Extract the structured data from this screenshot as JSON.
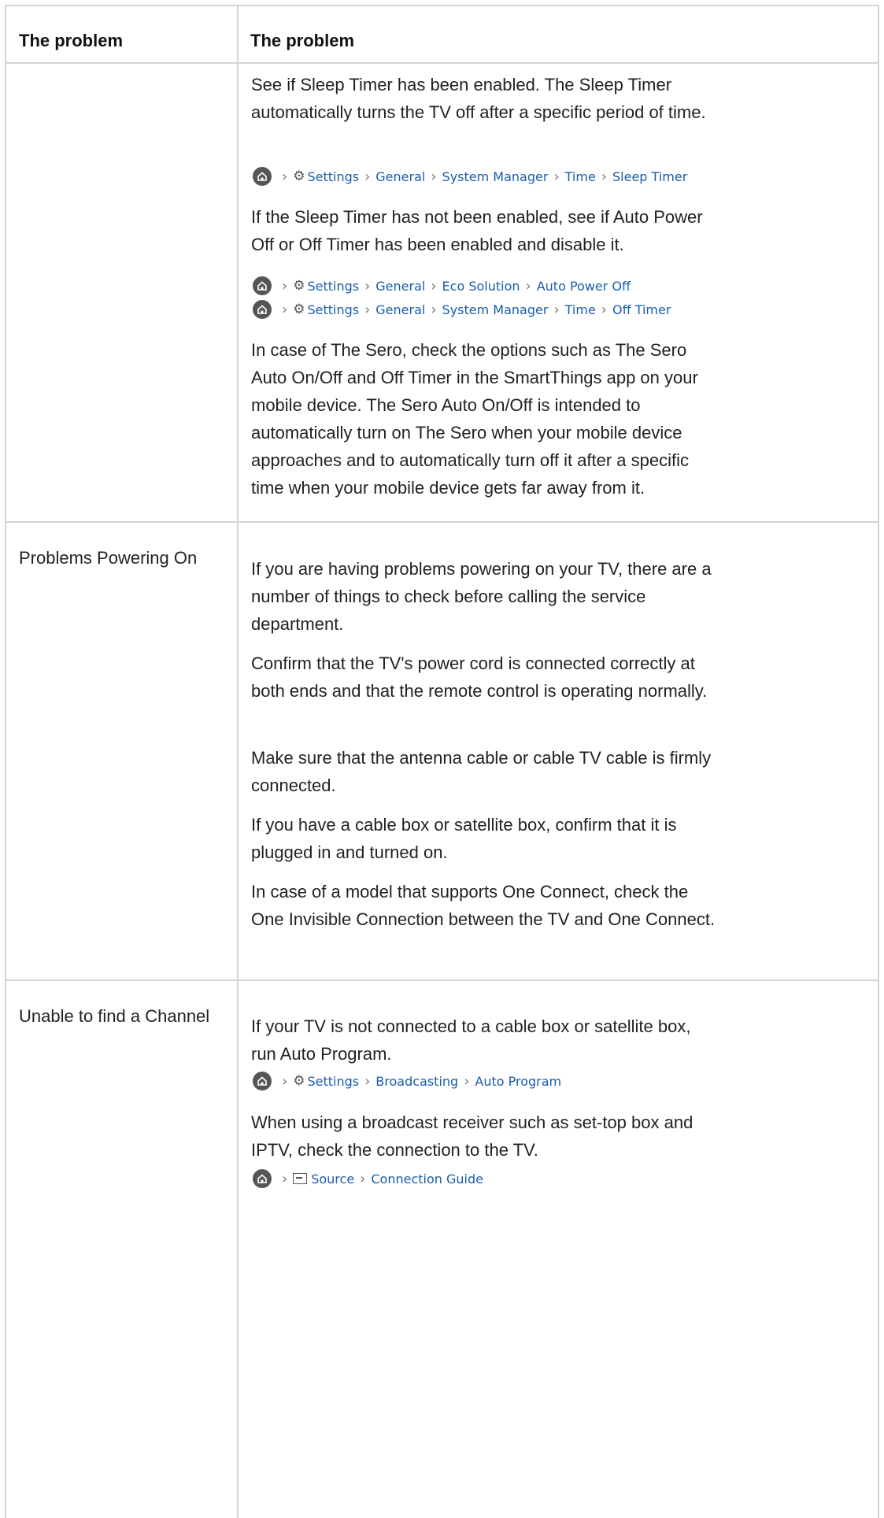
{
  "header": {
    "col1": "The problem",
    "col2": "The problem"
  },
  "path_sep": "›",
  "section1": {
    "p1": "See if Sleep Timer has been enabled. The Sleep Timer automatically turns the TV off after a specific period of time.",
    "path1": [
      "Settings",
      "General",
      "System Manager",
      "Time",
      "Sleep Timer"
    ],
    "p2": "If the Sleep Timer has not been enabled, see if Auto Power Off or Off Timer has been enabled and disable it.",
    "path2": [
      "Settings",
      "General",
      "Eco Solution",
      "Auto Power Off"
    ],
    "path3": [
      "Settings",
      "General",
      "System Manager",
      "Time",
      "Off Timer"
    ],
    "p3": "In case of The Sero, check the options such as The Sero Auto On/Off and Off Timer in the SmartThings app on your mobile device. The Sero Auto On/Off is intended to automatically turn on The Sero when your mobile device approaches and to automatically turn off it after a specific time when your mobile device gets far away from it."
  },
  "section2": {
    "label": "Problems Powering On",
    "p1": "If you are having problems powering on your TV, there are a number of things to check before calling the service department.",
    "p2": "Confirm that the TV's power cord is connected correctly at both ends and that the remote control is operating normally.",
    "p3": "Make sure that the antenna cable or cable TV cable is firmly connected.",
    "p4": "If you have a cable box or satellite box, confirm that it is plugged in and turned on.",
    "p5": "In case of a model that supports One Connect, check the One Invisible Connection between the TV and One Connect."
  },
  "section3": {
    "label": "Unable to find a Channel",
    "p1": "If your TV is not connected to a cable box or satellite box, run Auto Program.",
    "path1": [
      "Settings",
      "Broadcasting",
      "Auto Program"
    ],
    "p2": "When using a broadcast receiver such as set-top box and IPTV, check the connection to the TV.",
    "path2": [
      "Source",
      "Connection Guide"
    ]
  }
}
